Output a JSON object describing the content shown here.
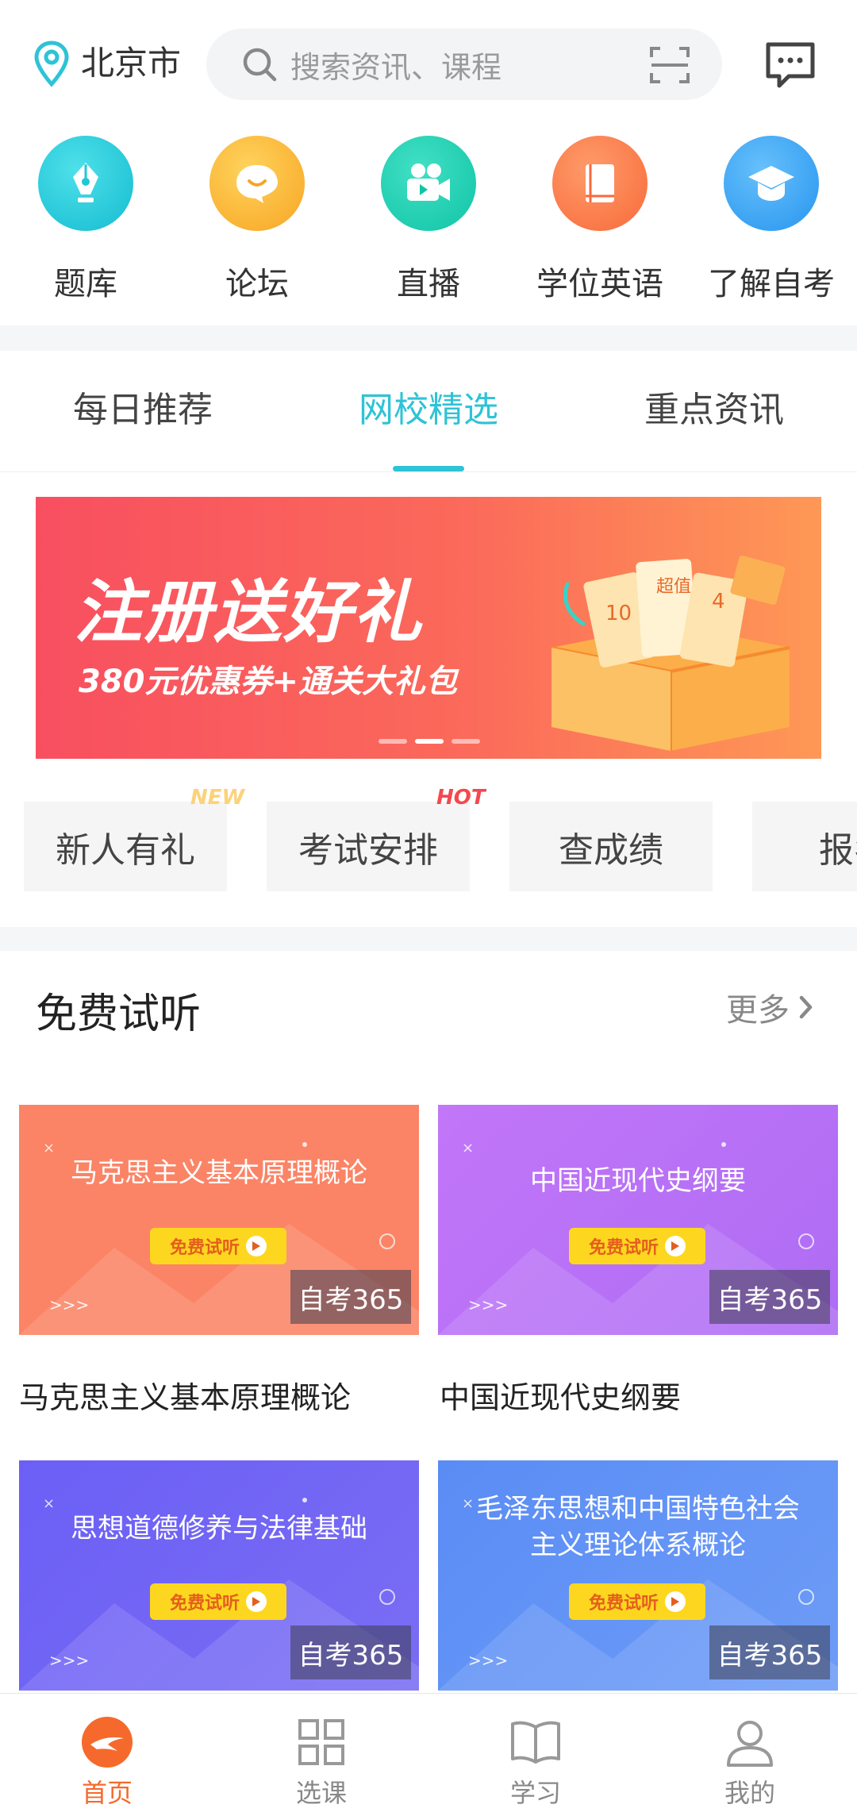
{
  "header": {
    "location": "北京市",
    "search_placeholder": "搜索资讯、课程"
  },
  "quick_links": [
    {
      "label": "题库",
      "icon": "pen-nib-icon",
      "color": "#1fc8d5"
    },
    {
      "label": "论坛",
      "icon": "chat-bubble-icon",
      "color": "#fcb33a"
    },
    {
      "label": "直播",
      "icon": "video-camera-icon",
      "color": "#1ccdb1"
    },
    {
      "label": "学位英语",
      "icon": "book-icon",
      "color": "#fb7d4c"
    },
    {
      "label": "了解自考",
      "icon": "graduation-cap-icon",
      "color": "#3ba5f3"
    }
  ],
  "tabs": [
    {
      "label": "每日推荐",
      "active": false
    },
    {
      "label": "网校精选",
      "active": true
    },
    {
      "label": "重点资讯",
      "active": false
    }
  ],
  "banner": {
    "title": "注册送好礼",
    "subtitle": "380元优惠券+通关大礼包",
    "ticket_text": "超值",
    "ticket_num": "10",
    "ticket_num2": "4",
    "page_count": 3,
    "current_page": 2
  },
  "chips": [
    {
      "label": "新人有礼",
      "tag": "NEW"
    },
    {
      "label": "考试安排",
      "tag": "HOT"
    },
    {
      "label": "查成绩",
      "tag": ""
    },
    {
      "label": "报名",
      "tag": ""
    }
  ],
  "free_trial": {
    "title": "免费试听",
    "more": "更多",
    "button_label": "免费试听",
    "badge": "自考365",
    "arrows": ">>>",
    "courses": [
      {
        "card_title": "马克思主义基本原理概论",
        "name": "马克思主义基本原理概论",
        "color": "#fb8466"
      },
      {
        "card_title": "中国近现代史纲要",
        "name": "中国近现代史纲要",
        "color": "#b872f7"
      },
      {
        "card_title": "思想道德修养与法律基础",
        "name": "",
        "color": "#6f63f4"
      },
      {
        "card_title_line1": "毛泽东思想和中国特色社会",
        "card_title_line2": "主义理论体系概论",
        "name": "",
        "color": "#5f8ff4"
      }
    ]
  },
  "nav": [
    {
      "label": "首页",
      "icon": "home-logo-icon",
      "active": true
    },
    {
      "label": "选课",
      "icon": "grid-icon",
      "active": false
    },
    {
      "label": "学习",
      "icon": "open-book-icon",
      "active": false
    },
    {
      "label": "我的",
      "icon": "user-icon",
      "active": false
    }
  ],
  "colors": {
    "accent": "#2ec3d6",
    "nav_active": "#f56a2c"
  }
}
